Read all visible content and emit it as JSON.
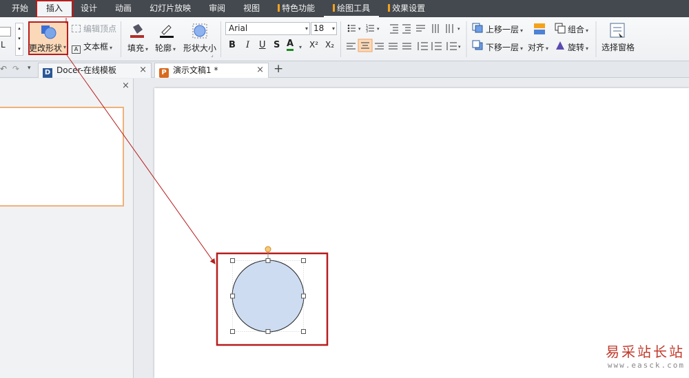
{
  "menu": {
    "tabs": [
      {
        "label": "开始"
      },
      {
        "label": "插入"
      },
      {
        "label": "设计"
      },
      {
        "label": "动画"
      },
      {
        "label": "幻灯片放映"
      },
      {
        "label": "审阅"
      },
      {
        "label": "视图"
      },
      {
        "label": "特色功能"
      },
      {
        "label": "绘图工具"
      },
      {
        "label": "效果设置"
      }
    ]
  },
  "ribbon": {
    "change_shape": "更改形状",
    "edit_points": "编辑顶点",
    "text_box": "文本框",
    "fill": "填充",
    "outline": "轮廓",
    "shape_size": "形状大小",
    "font_name": "Arial",
    "font_size": "18",
    "bring_forward": "上移一层",
    "send_backward": "下移一层",
    "group": "组合",
    "align": "对齐",
    "rotate": "旋转",
    "selection_pane": "选择窗格",
    "left_cut_label": "L",
    "bold": "B",
    "italic": "I",
    "underline": "U",
    "strike": "S",
    "font_color": "A",
    "superscript": "X²",
    "subscript": "X₂"
  },
  "doc_tabs": [
    {
      "label": "Docer-在线模板",
      "close": "×"
    },
    {
      "label": "演示文稿1 *",
      "close": "×"
    }
  ],
  "new_tab": "+",
  "panel_close": "×",
  "watermark": {
    "title": "易采站长站",
    "url": "www.easck.com"
  },
  "colors": {
    "highlight": "#b71c1c",
    "accent_orange": "#f4a21d",
    "circle_fill": "#cddcf1",
    "menubar_bg": "#44494f"
  }
}
